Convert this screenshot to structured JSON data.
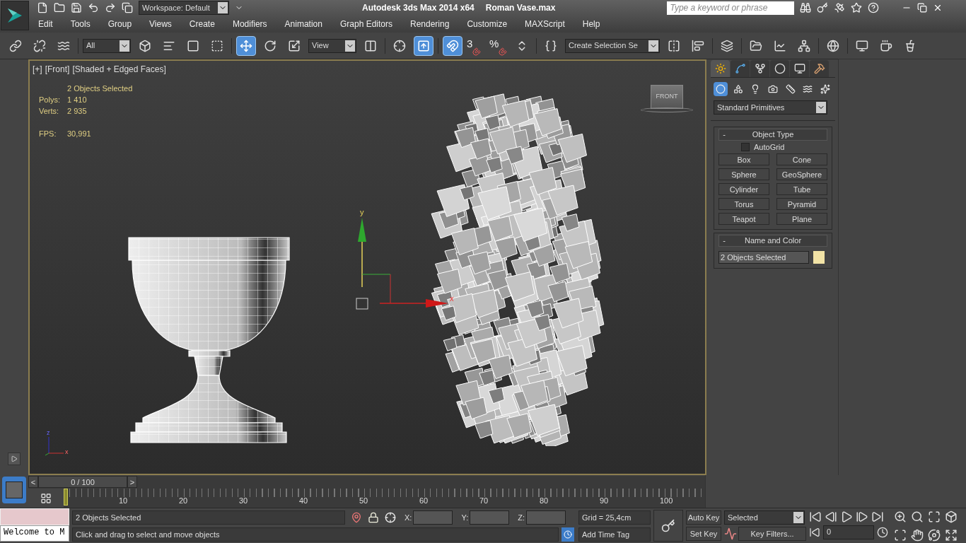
{
  "title_bar": {
    "workspace": "Workspace: Default",
    "app_title": "Autodesk 3ds Max  2014 x64",
    "file_name": "Roman Vase.max",
    "search": {
      "placeholder": "Type a keyword or phrase"
    }
  },
  "menu": [
    "Edit",
    "Tools",
    "Group",
    "Views",
    "Create",
    "Modifiers",
    "Animation",
    "Graph Editors",
    "Rendering",
    "Customize",
    "MAXScript",
    "Help"
  ],
  "toolbar": [
    {
      "kind": "tool",
      "selected": false
    },
    {
      "kind": "tool",
      "selected": false
    },
    {
      "kind": "tool",
      "selected": false
    },
    {
      "kind": "sep"
    },
    {
      "kind": "dropdown",
      "value": "All"
    },
    {
      "kind": "tool",
      "selected": false
    },
    {
      "kind": "tool",
      "selected": false
    },
    {
      "kind": "tool",
      "selected": false
    },
    {
      "kind": "tool",
      "selected": false
    },
    {
      "kind": "sep"
    },
    {
      "kind": "tool",
      "selected": true
    },
    {
      "kind": "tool",
      "selected": false
    },
    {
      "kind": "tool",
      "selected": false
    },
    {
      "kind": "dropdown",
      "value": "View"
    },
    {
      "kind": "tool",
      "selected": false
    },
    {
      "kind": "sep"
    },
    {
      "kind": "tool",
      "selected": false
    },
    {
      "kind": "tool",
      "selected": true
    },
    {
      "kind": "sep"
    },
    {
      "kind": "tool",
      "selected": true
    },
    {
      "kind": "snap",
      "glyph": "3"
    },
    {
      "kind": "snap",
      "glyph": "%"
    },
    {
      "kind": "tool",
      "selected": false
    },
    {
      "kind": "sep"
    },
    {
      "kind": "tool",
      "selected": false
    },
    {
      "kind": "dropdown",
      "value": "Create Selection Se"
    },
    {
      "kind": "tool",
      "selected": false
    },
    {
      "kind": "tool",
      "selected": false
    },
    {
      "kind": "sep"
    },
    {
      "kind": "tool",
      "selected": false
    },
    {
      "kind": "sep"
    },
    {
      "kind": "tool",
      "selected": false
    },
    {
      "kind": "tool",
      "selected": false
    },
    {
      "kind": "tool",
      "selected": false
    },
    {
      "kind": "sep"
    },
    {
      "kind": "tool",
      "selected": false
    },
    {
      "kind": "sep"
    },
    {
      "kind": "tool",
      "selected": false
    },
    {
      "kind": "tool",
      "selected": false
    },
    {
      "kind": "tool",
      "selected": false
    }
  ],
  "viewport": {
    "labels": [
      "[+]",
      "[Front]",
      "[Shaded + Edged Faces]"
    ],
    "selection": "2 Objects Selected",
    "stats": [
      {
        "label": "Polys:",
        "value": "1 410"
      },
      {
        "label": "Verts:",
        "value": "2 935"
      },
      {
        "label": "FPS:",
        "value": "30,991"
      }
    ],
    "viewcube_label": "FRONT",
    "gizmo_axes": [
      "y",
      "x"
    ],
    "tripod_axes": [
      "z",
      "x"
    ]
  },
  "command_panel": {
    "tabs": [
      {
        "selected": true
      },
      {
        "selected": false
      },
      {
        "selected": false
      },
      {
        "selected": false
      },
      {
        "selected": false
      },
      {
        "selected": false
      }
    ],
    "categories": [
      {
        "selected": true
      },
      {
        "selected": false
      },
      {
        "selected": false
      },
      {
        "selected": false
      },
      {
        "selected": false
      },
      {
        "selected": false
      },
      {
        "selected": false
      }
    ],
    "dropdown": "Standard Primitives",
    "object_type": {
      "title": "Object Type",
      "toggle": "-",
      "autogrid": {
        "label": "AutoGrid",
        "checked": false
      },
      "buttons": [
        "Box",
        "Cone",
        "Sphere",
        "GeoSphere",
        "Cylinder",
        "Tube",
        "Torus",
        "Pyramid",
        "Teapot",
        "Plane"
      ]
    },
    "name_and_color": {
      "title": "Name and Color",
      "toggle": "-",
      "name": "2 Objects Selected",
      "color": "#f2e3a6"
    }
  },
  "timeline": {
    "prev": "<",
    "next": ">",
    "thumb": "0 / 100",
    "frame_labels": [
      "10",
      "20",
      "30",
      "40",
      "50",
      "60",
      "70",
      "80",
      "90",
      "100"
    ]
  },
  "status": {
    "welcome": "Welcome to M",
    "selection": "2 Objects Selected",
    "prompt": "Click and drag to select and move objects",
    "coords": [
      "X:",
      "Y:",
      "Z:"
    ],
    "grid": "Grid = 25,4cm",
    "time_tag": "Add Time Tag",
    "auto_key": "Auto Key",
    "set_key": "Set Key",
    "key_mode": "Selected",
    "key_filters": "Key Filters...",
    "frame": "0"
  }
}
